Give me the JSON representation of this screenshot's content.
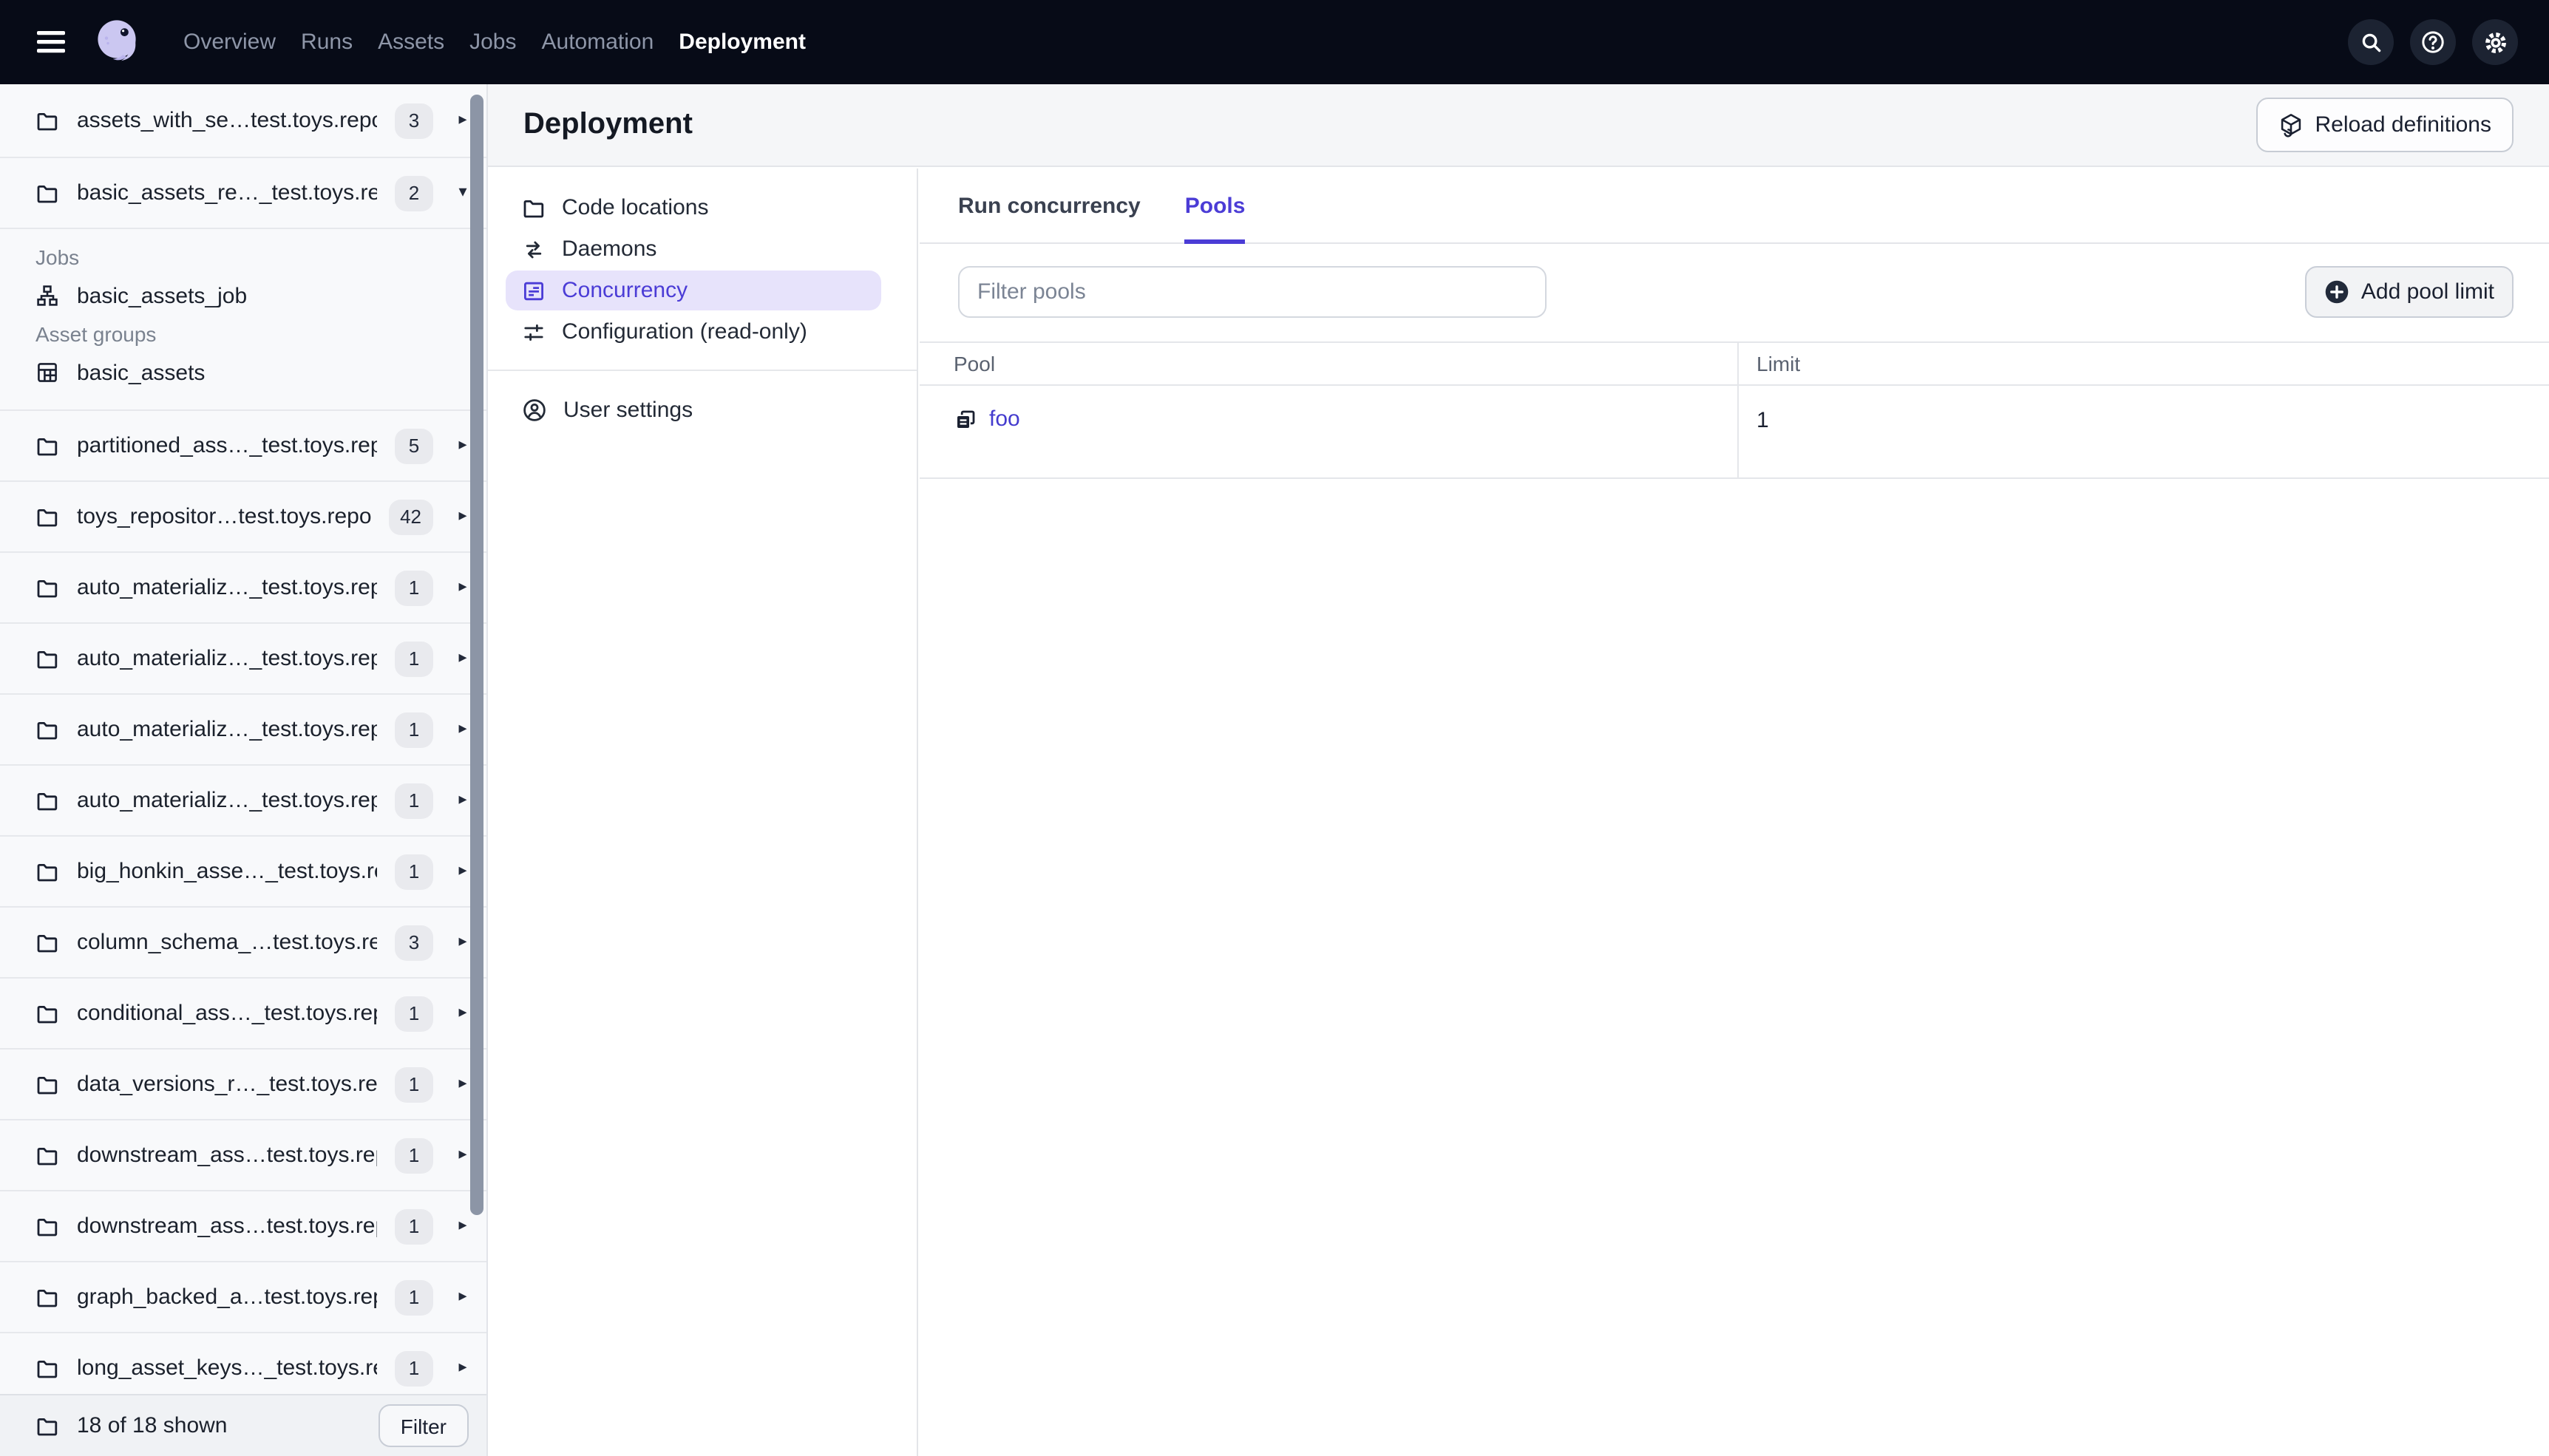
{
  "topnav": {
    "items": [
      {
        "label": "Overview",
        "active": false
      },
      {
        "label": "Runs",
        "active": false
      },
      {
        "label": "Assets",
        "active": false
      },
      {
        "label": "Jobs",
        "active": false
      },
      {
        "label": "Automation",
        "active": false
      },
      {
        "label": "Deployment",
        "active": true
      }
    ],
    "actions": [
      "search",
      "help",
      "settings"
    ]
  },
  "sidebar": {
    "items": [
      {
        "name": "assets_with_se…test.toys.repo",
        "count": "3",
        "expanded": false
      },
      {
        "name": "basic_assets_re…_test.toys.repo",
        "count": "2",
        "expanded": true,
        "sections": [
          {
            "label": "Jobs",
            "entries": [
              {
                "icon": "job",
                "label": "basic_assets_job"
              }
            ]
          },
          {
            "label": "Asset groups",
            "entries": [
              {
                "icon": "asset-group",
                "label": "basic_assets"
              }
            ]
          }
        ]
      },
      {
        "name": "partitioned_ass…_test.toys.repo",
        "count": "5",
        "expanded": false
      },
      {
        "name": "toys_repositor…test.toys.repo",
        "count": "42",
        "expanded": false
      },
      {
        "name": "auto_materializ…_test.toys.repo",
        "count": "1",
        "expanded": false
      },
      {
        "name": "auto_materializ…_test.toys.repo",
        "count": "1",
        "expanded": false
      },
      {
        "name": "auto_materializ…_test.toys.repo",
        "count": "1",
        "expanded": false
      },
      {
        "name": "auto_materializ…_test.toys.repo",
        "count": "1",
        "expanded": false
      },
      {
        "name": "big_honkin_asse…_test.toys.repo",
        "count": "1",
        "expanded": false
      },
      {
        "name": "column_schema_…test.toys.repo",
        "count": "3",
        "expanded": false
      },
      {
        "name": "conditional_ass…_test.toys.repo",
        "count": "1",
        "expanded": false
      },
      {
        "name": "data_versions_r…_test.toys.repo",
        "count": "1",
        "expanded": false
      },
      {
        "name": "downstream_ass…test.toys.repo",
        "count": "1",
        "expanded": false
      },
      {
        "name": "downstream_ass…test.toys.repo",
        "count": "1",
        "expanded": false
      },
      {
        "name": "graph_backed_a…test.toys.repo",
        "count": "1",
        "expanded": false
      },
      {
        "name": "long_asset_keys…_test.toys.repo",
        "count": "1",
        "expanded": false
      }
    ],
    "footer": {
      "summary": "18 of 18 shown",
      "filter_label": "Filter"
    }
  },
  "header": {
    "title": "Deployment",
    "reload_label": "Reload definitions"
  },
  "deployment_nav": {
    "items": [
      {
        "label": "Code locations",
        "icon": "folder",
        "selected": false
      },
      {
        "label": "Daemons",
        "icon": "daemons",
        "selected": false
      },
      {
        "label": "Concurrency",
        "icon": "concurrency",
        "selected": true
      },
      {
        "label": "Configuration (read-only)",
        "icon": "config",
        "selected": false
      }
    ],
    "secondary": [
      {
        "label": "User settings",
        "icon": "user",
        "selected": false
      }
    ]
  },
  "tabs": [
    {
      "label": "Run concurrency",
      "active": false
    },
    {
      "label": "Pools",
      "active": true
    }
  ],
  "pools": {
    "filter_placeholder": "Filter pools",
    "add_button_label": "Add pool limit",
    "table": {
      "columns": [
        "Pool",
        "Limit"
      ],
      "rows": [
        {
          "pool": "foo",
          "limit": "1"
        }
      ]
    }
  },
  "colors": {
    "accent": "#4B3CD6",
    "nav_bg": "#070B17",
    "selected_item_bg": "#E7E3FB",
    "link": "#443BCE",
    "header_bg": "#F5F6F8",
    "sidebar_bg": "#F8F9FB"
  }
}
